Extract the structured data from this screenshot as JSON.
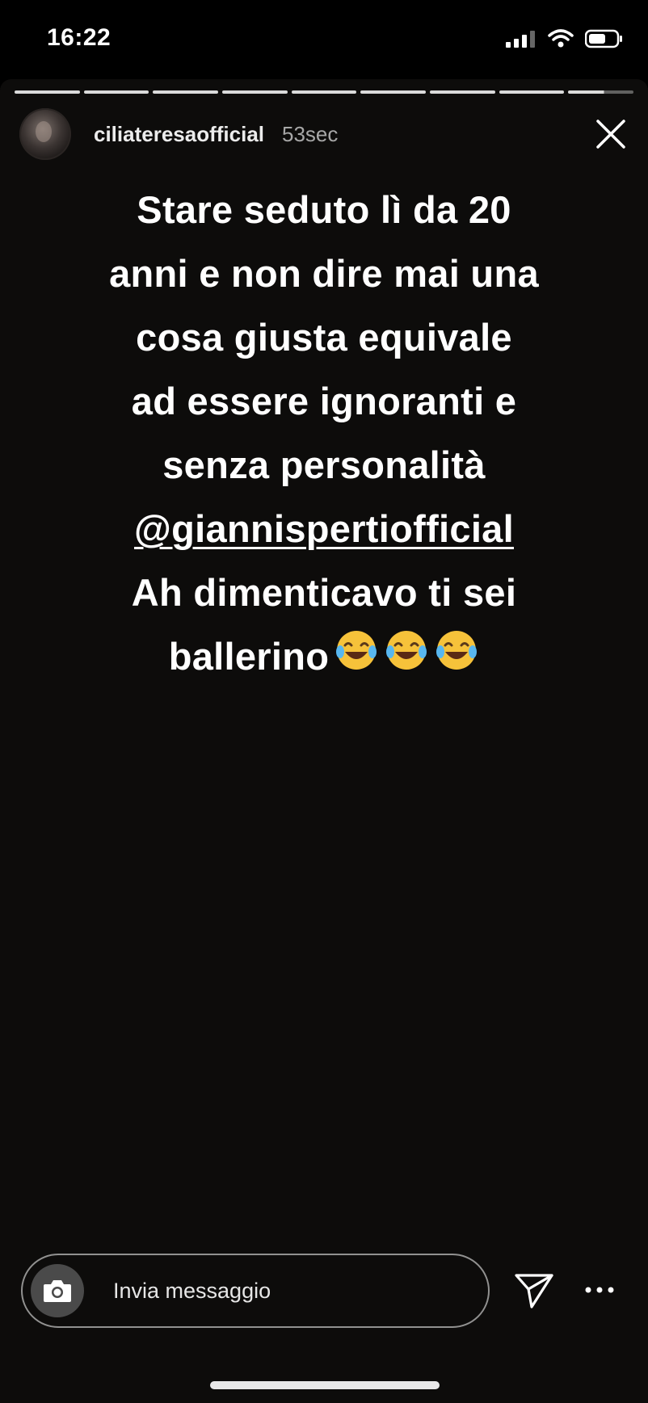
{
  "status_bar": {
    "time": "16:22",
    "icons": [
      "signal-icon",
      "wifi-icon",
      "battery-icon"
    ]
  },
  "story": {
    "progress_segments": 9,
    "current_segment_progress": 0.55,
    "user": {
      "username": "ciliateresaofficial",
      "time_ago": "53sec"
    },
    "text_lines": [
      "Stare seduto lì da 20",
      "anni e non dire mai una",
      "cosa giusta equivale",
      "ad essere ignoranti e",
      "senza personalità"
    ],
    "mention": "@giannispertiofficial",
    "text_lines_after": [
      "Ah dimenticavo ti sei"
    ],
    "last_line_text": "ballerino",
    "emojis": [
      "😂",
      "😂",
      "😂"
    ]
  },
  "reply_bar": {
    "placeholder": "Invia messaggio"
  },
  "colors": {
    "background": "#0d0c0b",
    "text": "#ffffff",
    "secondary_text": "#a7a7a7"
  }
}
